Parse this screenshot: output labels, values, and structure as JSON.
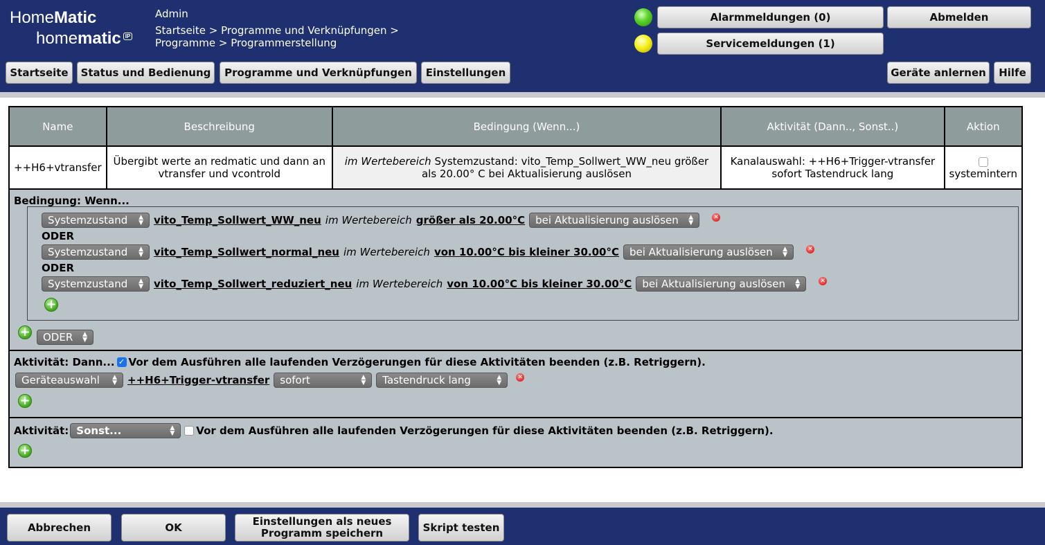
{
  "header": {
    "logo_top_a": "Home",
    "logo_top_b": "Matic",
    "logo_bottom_a": "home",
    "logo_bottom_b": "matic",
    "logo_badge": "IP",
    "user": "Admin",
    "breadcrumb_line1": "Startseite > Programme und Verknüpfungen >",
    "breadcrumb_line2": "Programme > Programmerstellung",
    "alarm_button": "Alarmmeldungen (0)",
    "service_button": "Servicemeldungen (1)",
    "logout_button": "Abmelden",
    "nav": {
      "home": "Startseite",
      "status": "Status und Bedienung",
      "programs": "Programme und Verknüpfungen",
      "settings": "Einstellungen",
      "teach": "Geräte anlernen",
      "help": "Hilfe"
    },
    "colors": {
      "bar": "#1f3070",
      "led_alarm": "#5ed62c",
      "led_service": "#f3f01a"
    }
  },
  "program_table": {
    "headers": [
      "Name",
      "Beschreibung",
      "Bedingung (Wenn...)",
      "Aktivität (Dann.., Sonst..)",
      "Aktion"
    ],
    "row": {
      "name": "++H6+vtransfer",
      "description": "Übergibt werte an redmatic und dann an vtransfer und vcontrold",
      "condition_italic": "im Wertebereich",
      "condition_rest": " Systemzustand: vito_Temp_Sollwert_WW_neu größer als 20.00° C bei Aktualisierung auslösen",
      "activity": "Kanalauswahl: ++H6+Trigger-vtransfer sofort Tastendruck lang",
      "action_label": "systemintern"
    }
  },
  "condition": {
    "title": "Bedingung: Wenn...",
    "or_label": "ODER",
    "range_text": "im Wertebereich",
    "rows": [
      {
        "type": "Systemzustand",
        "variable": "vito_Temp_Sollwert_WW_neu",
        "range": "größer als 20.00°C",
        "trigger": "bei Aktualisierung auslösen"
      },
      {
        "type": "Systemzustand",
        "variable": "vito_Temp_Sollwert_normal_neu",
        "range": "von 10.00°C bis kleiner 30.00°C",
        "trigger": "bei Aktualisierung auslösen"
      },
      {
        "type": "Systemzustand",
        "variable": "vito_Temp_Sollwert_reduziert_neu",
        "range": "von 10.00°C bis kleiner 30.00°C",
        "trigger": "bei Aktualisierung auslösen"
      }
    ],
    "combine_select": "ODER"
  },
  "activity_then": {
    "title": "Aktivität: Dann...",
    "stop_delays_label": "Vor dem Ausführen alle laufenden Verzögerungen für diese Aktivitäten beenden (z.B. Retriggern).",
    "stop_delays_checked": true,
    "select_type": "Geräteauswahl",
    "device": "++H6+Trigger-vtransfer",
    "timing": "sofort",
    "action": "Tastendruck lang"
  },
  "activity_else": {
    "title": "Aktivität:",
    "select": "Sonst...",
    "stop_delays_label": "Vor dem Ausführen alle laufenden Verzögerungen für diese Aktivitäten beenden (z.B. Retriggern).",
    "stop_delays_checked": false
  },
  "footer": {
    "cancel": "Abbrechen",
    "ok": "OK",
    "save_new_line1": "Einstellungen als neues",
    "save_new_line2": "Programm speichern",
    "test_script": "Skript testen"
  }
}
